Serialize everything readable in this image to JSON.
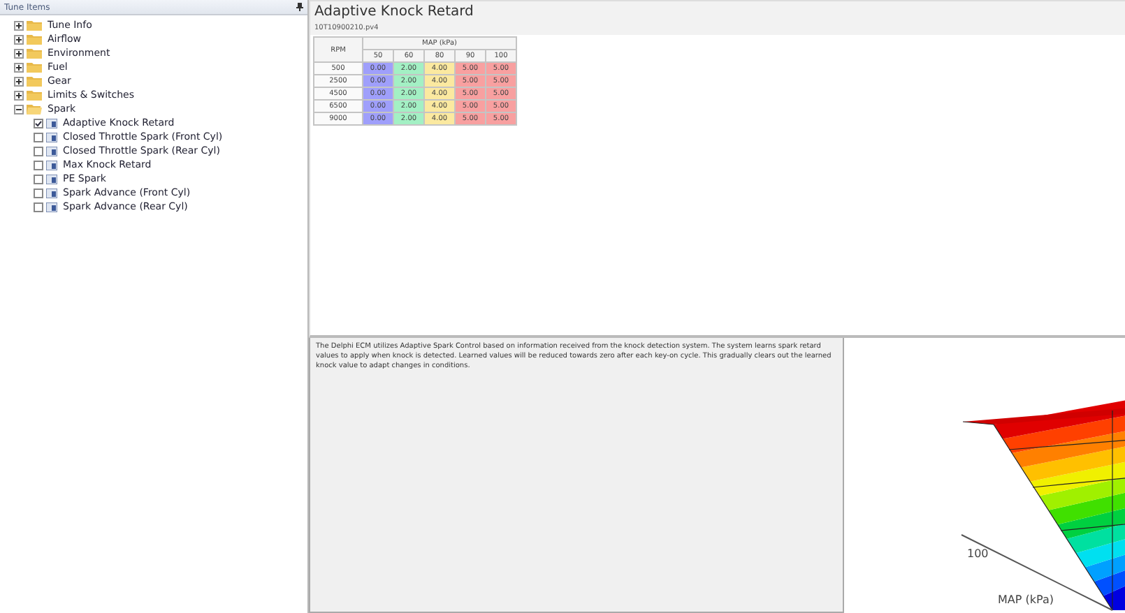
{
  "sidebar": {
    "title": "Tune Items",
    "items": [
      {
        "label": "Tune Info",
        "expanded": false
      },
      {
        "label": "Airflow",
        "expanded": false
      },
      {
        "label": "Environment",
        "expanded": false
      },
      {
        "label": "Fuel",
        "expanded": false
      },
      {
        "label": "Gear",
        "expanded": false
      },
      {
        "label": "Limits & Switches",
        "expanded": false
      },
      {
        "label": "Spark",
        "expanded": true,
        "children": [
          {
            "label": "Adaptive Knock Retard",
            "selected": true
          },
          {
            "label": "Closed Throttle Spark (Front Cyl)",
            "selected": false
          },
          {
            "label": "Closed Throttle Spark (Rear Cyl)",
            "selected": false
          },
          {
            "label": "Max Knock Retard",
            "selected": false
          },
          {
            "label": "PE Spark",
            "selected": false
          },
          {
            "label": "Spark Advance (Front Cyl)",
            "selected": false
          },
          {
            "label": "Spark Advance (Rear Cyl)",
            "selected": false
          }
        ]
      }
    ]
  },
  "table_view": {
    "title": "Adaptive Knock Retard",
    "file": "10T10900210.pv4",
    "row_header": "RPM",
    "column_group": "MAP (kPa)",
    "columns": [
      "50",
      "60",
      "80",
      "90",
      "100"
    ],
    "rows": [
      {
        "label": "500",
        "cells": [
          {
            "value": "0.00",
            "color": "#9f9ffb"
          },
          {
            "value": "2.00",
            "color": "#a3f0c4"
          },
          {
            "value": "4.00",
            "color": "#fbe9a0"
          },
          {
            "value": "5.00",
            "color": "#f8a0a0"
          },
          {
            "value": "5.00",
            "color": "#f8a0a0"
          }
        ]
      },
      {
        "label": "2500",
        "cells": [
          {
            "value": "0.00",
            "color": "#9f9ffb"
          },
          {
            "value": "2.00",
            "color": "#a3f0c4"
          },
          {
            "value": "4.00",
            "color": "#fbe9a0"
          },
          {
            "value": "5.00",
            "color": "#f8a0a0"
          },
          {
            "value": "5.00",
            "color": "#f8a0a0"
          }
        ]
      },
      {
        "label": "4500",
        "cells": [
          {
            "value": "0.00",
            "color": "#9f9ffb"
          },
          {
            "value": "2.00",
            "color": "#a3f0c4"
          },
          {
            "value": "4.00",
            "color": "#fbe9a0"
          },
          {
            "value": "5.00",
            "color": "#f8a0a0"
          },
          {
            "value": "5.00",
            "color": "#f8a0a0"
          }
        ]
      },
      {
        "label": "6500",
        "cells": [
          {
            "value": "0.00",
            "color": "#9f9ffb"
          },
          {
            "value": "2.00",
            "color": "#a3f0c4"
          },
          {
            "value": "4.00",
            "color": "#fbe9a0"
          },
          {
            "value": "5.00",
            "color": "#f8a0a0"
          },
          {
            "value": "5.00",
            "color": "#f8a0a0"
          }
        ]
      },
      {
        "label": "9000",
        "cells": [
          {
            "value": "0.00",
            "color": "#9f9ffb"
          },
          {
            "value": "2.00",
            "color": "#a3f0c4"
          },
          {
            "value": "4.00",
            "color": "#fbe9a0"
          },
          {
            "value": "5.00",
            "color": "#f8a0a0"
          },
          {
            "value": "5.00",
            "color": "#f8a0a0"
          }
        ]
      }
    ]
  },
  "description": "The Delphi ECM utilizes Adaptive Spark Control based on information received from the knock detection system.  The system learns spark retard values to apply when knock is detected.  Learned values will be reduced towards zero after each key-on cycle. This gradually clears out the learned knock value to adapt  changes in conditions.",
  "surface_plot": {
    "tick": "100",
    "axis_label": "MAP (kPa)"
  }
}
